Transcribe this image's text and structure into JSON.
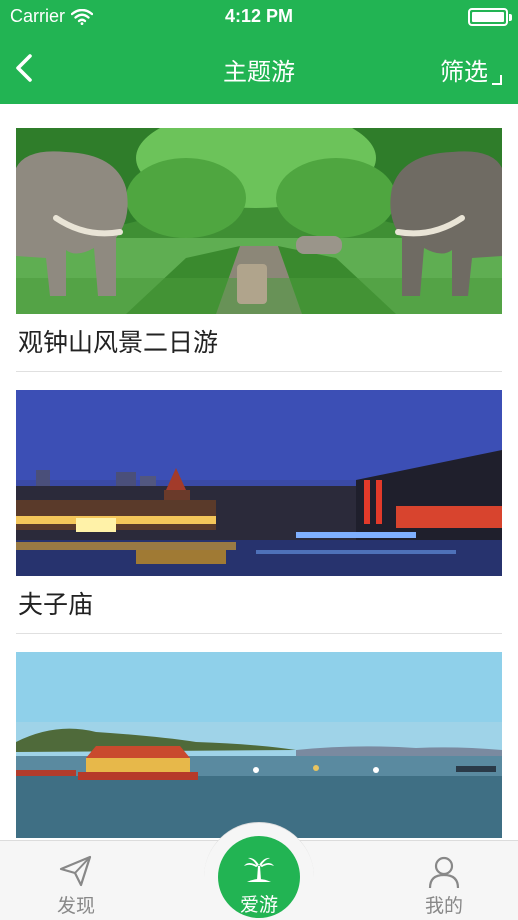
{
  "status_bar": {
    "carrier": "Carrier",
    "time": "4:12 PM"
  },
  "nav": {
    "title": "主题游",
    "filter_label": "筛选"
  },
  "tours": [
    {
      "title": "观钟山风景二日游"
    },
    {
      "title": "夫子庙"
    },
    {
      "title": ""
    }
  ],
  "tabbar": {
    "discover": "发现",
    "love_travel": "爱游",
    "mine": "我的",
    "active": "love_travel"
  },
  "colors": {
    "brand_green": "#22b453",
    "tab_inactive": "#888888"
  },
  "icons": {
    "back": "chevron-left-icon",
    "wifi": "wifi-icon",
    "battery": "battery-icon",
    "discover": "paper-plane-icon",
    "love_travel": "palm-island-icon",
    "mine": "person-icon"
  }
}
